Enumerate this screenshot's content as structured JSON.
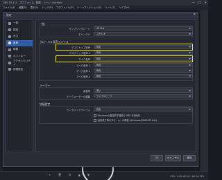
{
  "window": {
    "title": "OBS 29.1.3 - プロファイル: 無題 - シーン: Untitled",
    "controls": [
      "—",
      "□",
      "✕"
    ]
  },
  "menubar": [
    "ファイル(F)",
    "編集(E)",
    "表示(V)",
    "ドック(D)",
    "プロファイル(P)",
    "シーンコレクション(S)",
    "ツール(T)",
    "ヘルプ(H)"
  ],
  "dialog": {
    "title": "設定",
    "close": "✕"
  },
  "sidebar": {
    "items": [
      {
        "label": "一般",
        "icon": "gear-icon"
      },
      {
        "label": "配信",
        "icon": "broadcast-icon"
      },
      {
        "label": "出力",
        "icon": "output-icon"
      },
      {
        "label": "音声",
        "icon": "speaker-icon",
        "active": true
      },
      {
        "label": "映像",
        "icon": "monitor-icon"
      },
      {
        "label": "ホットキー",
        "icon": "keyboard-icon"
      },
      {
        "label": "アクセシビリティ",
        "icon": "accessibility-icon"
      },
      {
        "label": "詳細設定",
        "icon": "wrench-icon"
      }
    ]
  },
  "general": {
    "title": "一般",
    "rows": [
      {
        "label": "サンプリングレート",
        "value": "48 kHz"
      },
      {
        "label": "チャンネル",
        "value": "ステレオ"
      }
    ]
  },
  "global_audio": {
    "title": "グローバル音声デバイス",
    "rows": [
      {
        "label": "デスクトップ音声",
        "value": "既定",
        "highlighted": true
      },
      {
        "label": "デスクトップ音声 2",
        "value": "無効"
      },
      {
        "label": "マイク音声",
        "value": "既定",
        "highlighted": true
      },
      {
        "label": "マイク音声 2",
        "value": "無効"
      },
      {
        "label": "マイク音声 3",
        "value": "無効"
      },
      {
        "label": "マイク音声 4",
        "value": "無効"
      }
    ]
  },
  "meters": {
    "title": "メーター",
    "rows": [
      {
        "label": "減衰率",
        "value": "速い"
      },
      {
        "label": "ピークメーターの種類",
        "value": "サンプルピーク"
      }
    ]
  },
  "advanced": {
    "title": "詳細設定",
    "rows": [
      {
        "label": "モニタリングデバイス",
        "value": "既定"
      }
    ],
    "checkboxes": [
      "Windowsの音量低下機能で OBS を無効化",
      "音量低下時のスピーカーの移動 (WindowsのWASAPI のみ)"
    ]
  },
  "buttons": {
    "ok": "OK",
    "cancel": "キャンセル",
    "apply": "適用"
  },
  "background": {
    "controls": [
      "+",
      "🗑",
      "⚙",
      "▲",
      "▼"
    ],
    "status": "CPU: 1.0%  60.00 / 60.00 FPS"
  }
}
